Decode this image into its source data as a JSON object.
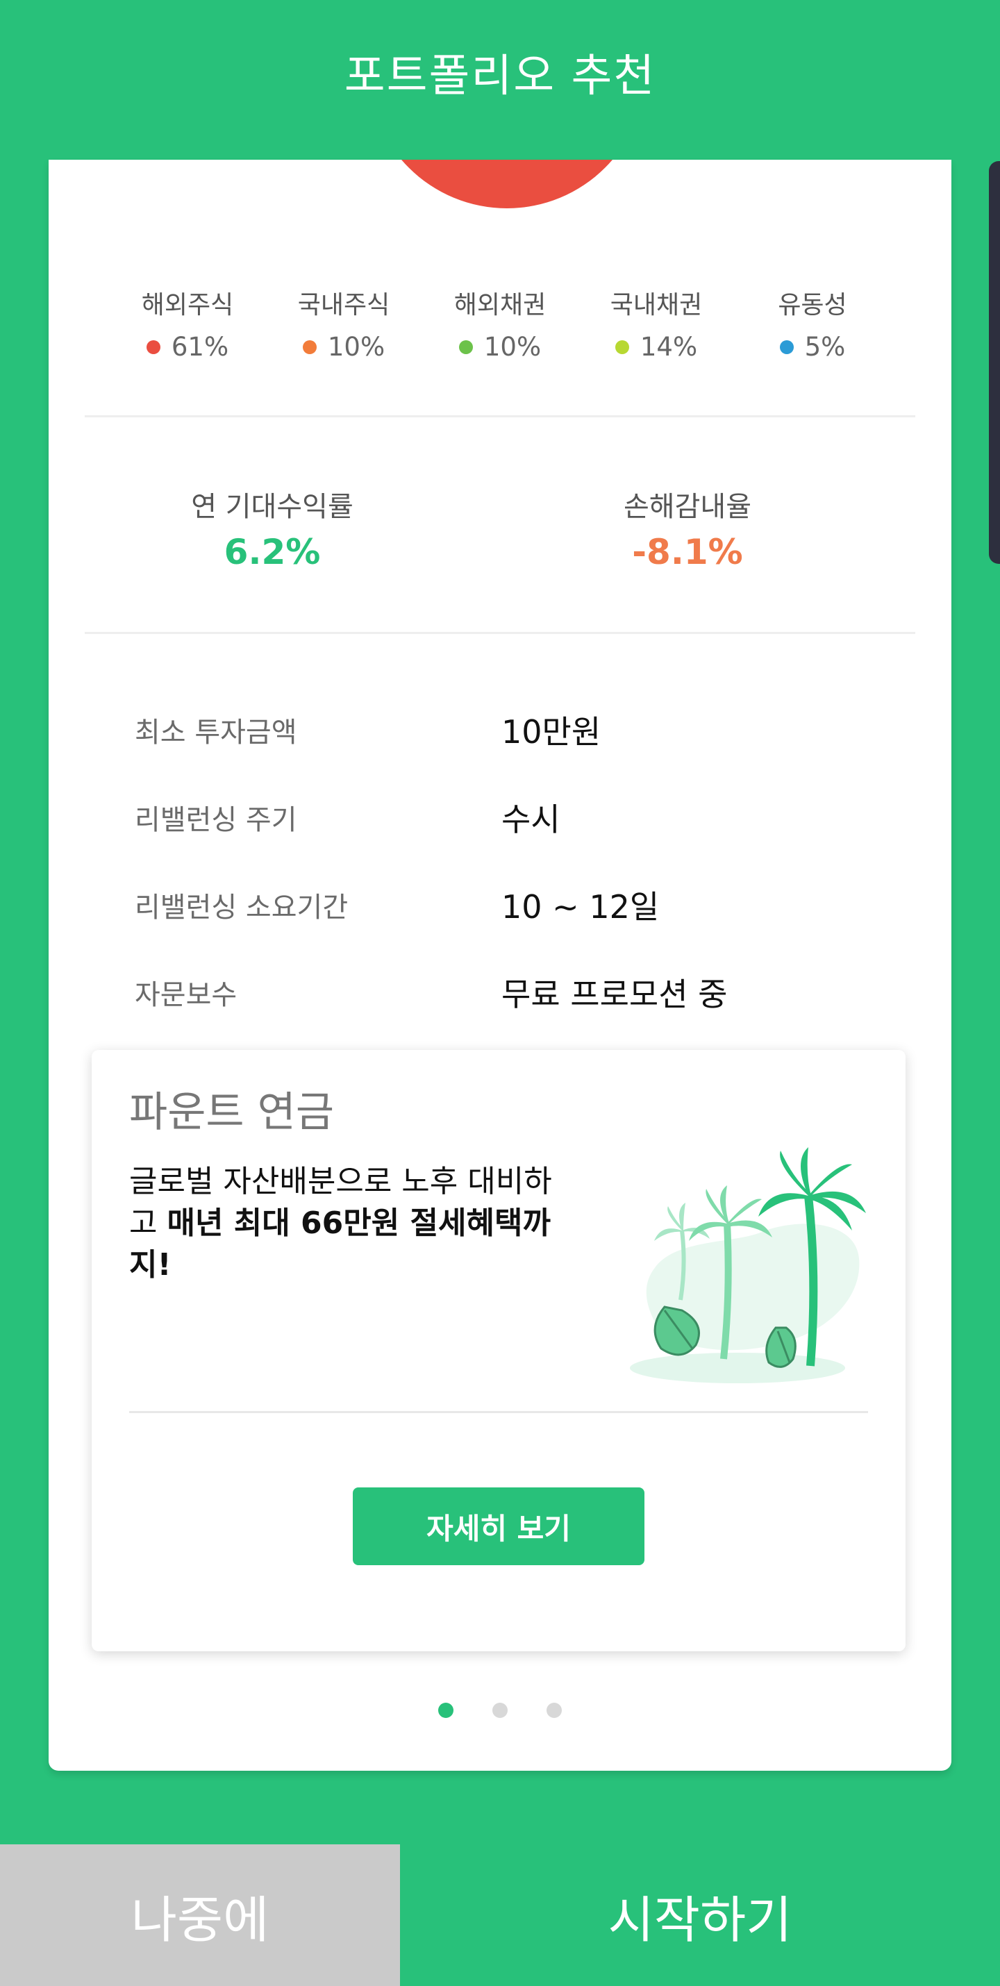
{
  "header": {
    "title": "포트폴리오 추천"
  },
  "allocation": [
    {
      "name": "해외주식",
      "value": "61%",
      "color": "#ea4e40"
    },
    {
      "name": "국내주식",
      "value": "10%",
      "color": "#f27c3a"
    },
    {
      "name": "해외채권",
      "value": "10%",
      "color": "#6cc24a"
    },
    {
      "name": "국내채권",
      "value": "14%",
      "color": "#b7d832"
    },
    {
      "name": "유동성",
      "value": "5%",
      "color": "#2b9bd6"
    }
  ],
  "metrics": {
    "expected_return": {
      "label": "연 기대수익률",
      "value": "6.2%",
      "color": "#28c17a"
    },
    "loss_tolerance": {
      "label": "손해감내율",
      "value": "-8.1%",
      "color": "#f07b4b"
    }
  },
  "info": [
    {
      "label": "최소 투자금액",
      "value": "10만원"
    },
    {
      "label": "리밸런싱 주기",
      "value": "수시"
    },
    {
      "label": "리밸런싱 소요기간",
      "value": "10 ~ 12일"
    },
    {
      "label": "자문보수",
      "value": "무료 프로모션 중"
    }
  ],
  "promo": {
    "title": "파운트 연금",
    "desc_part1": "글로벌 자산배분으로 노후 대비하고 ",
    "desc_bold1": "매년 최대 66만원 절세혜택까지!",
    "button_label": "자세히 보기",
    "illustration_icon": "palm-trees-illustration"
  },
  "pager": {
    "count": 3,
    "active_index": 0
  },
  "bottom": {
    "later_label": "나중에",
    "start_label": "시작하기"
  },
  "colors": {
    "brand": "#28c17a",
    "later_bg": "#cacaca"
  }
}
